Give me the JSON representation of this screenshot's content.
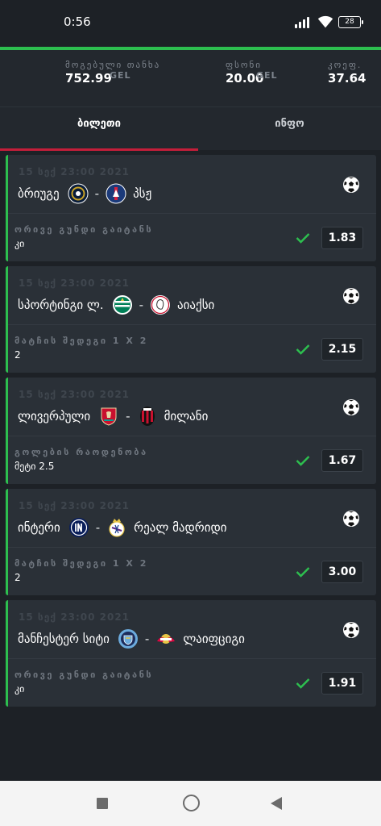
{
  "status": {
    "time": "0:56",
    "battery": "28"
  },
  "summary": {
    "win_label": "მოგებული თანხა",
    "win_value": "752.99",
    "win_currency": "GEL",
    "stake_label": "ფსონი",
    "stake_value": "20.00",
    "stake_currency": "GEL",
    "coef_label": "კოეფ.",
    "coef_value": "37.64"
  },
  "tabs": {
    "ticket": "ბილეთი",
    "info": "ინფო"
  },
  "bets": [
    {
      "date": "15 სექ 23:00 2021",
      "home": "ბრიუგე",
      "away": "პსჟ",
      "home_logo": "club-brugge-crest-icon",
      "away_logo": "psg-crest-icon",
      "market": "ორივე გუნდი გაიტანს",
      "selection": "კი",
      "odds": "1.83",
      "status_color": "#2dbf4f"
    },
    {
      "date": "15 სექ 23:00 2021",
      "home": "სპორტინგი ლ.",
      "away": "აიაქსი",
      "home_logo": "sporting-cp-crest-icon",
      "away_logo": "ajax-crest-icon",
      "market": "მატჩის შედეგი 1 X 2",
      "selection": "2",
      "odds": "2.15",
      "status_color": "#2dbf4f"
    },
    {
      "date": "15 სექ 23:00 2021",
      "home": "ლივერპული",
      "away": "მილანი",
      "home_logo": "liverpool-crest-icon",
      "away_logo": "ac-milan-crest-icon",
      "market": "გოლების რაოდენობა",
      "selection": "მეტი 2.5",
      "odds": "1.67",
      "status_color": "#2dbf4f"
    },
    {
      "date": "15 სექ 23:00 2021",
      "home": "ინტერი",
      "away": "რეალ მადრიდი",
      "home_logo": "inter-crest-icon",
      "away_logo": "real-madrid-crest-icon",
      "market": "მატჩის შედეგი 1 X 2",
      "selection": "2",
      "odds": "3.00",
      "status_color": "#2dbf4f"
    },
    {
      "date": "15 სექ 23:00 2021",
      "home": "მანჩესტერ სიტი",
      "away": "ლაიფციგი",
      "home_logo": "man-city-crest-icon",
      "away_logo": "rb-leipzig-crest-icon",
      "market": "ორივე გუნდი გაიტანს",
      "selection": "კი",
      "odds": "1.91",
      "status_color": "#2dbf4f"
    }
  ],
  "icons": {
    "sport": "soccer-ball-icon",
    "won": "check-icon"
  },
  "colors": {
    "accent_green": "#2dbf4f",
    "tab_underline": "#c41e3a",
    "background": "#1d2126",
    "card": "#2a3037"
  }
}
